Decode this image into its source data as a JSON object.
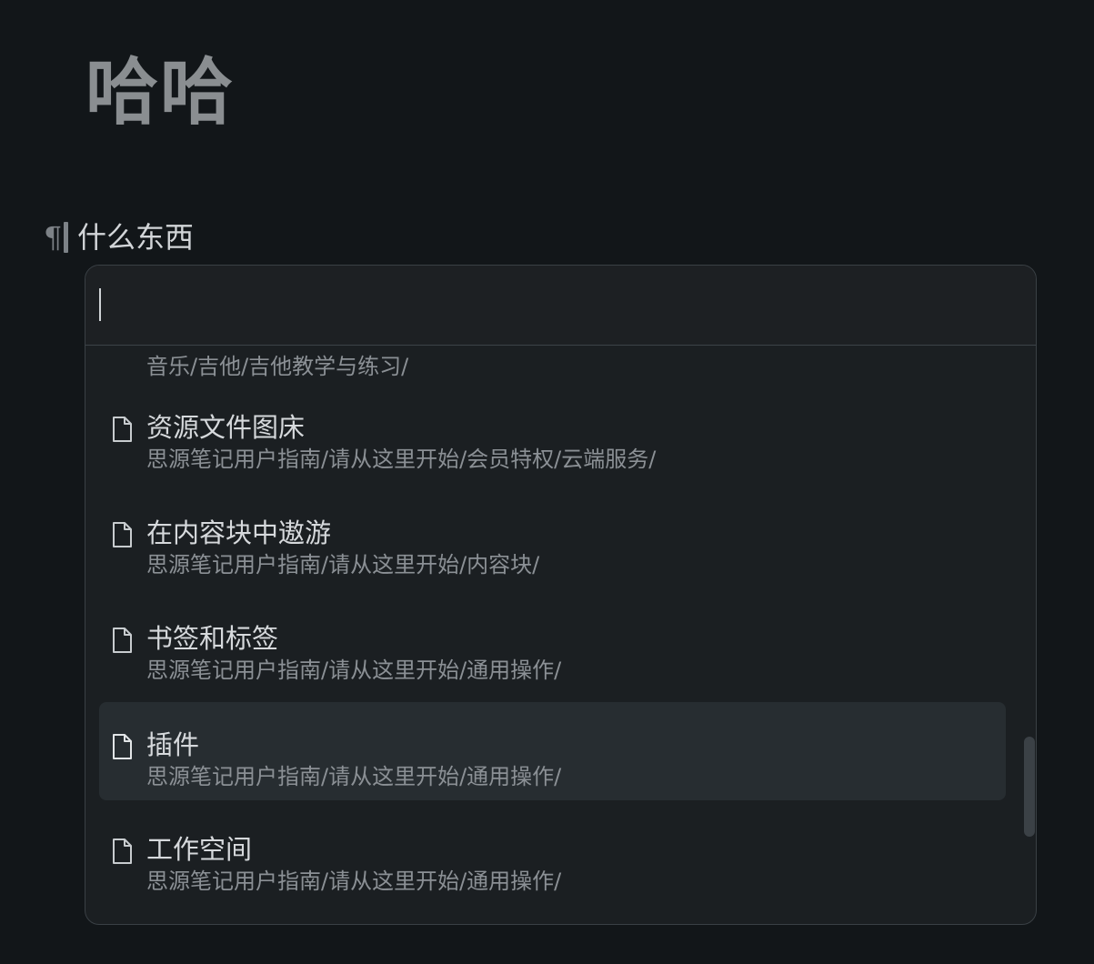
{
  "document": {
    "title": "哈哈",
    "paragraph_marker": "¶",
    "paragraph_text": "什么东西"
  },
  "search": {
    "value": "",
    "placeholder": ""
  },
  "results": {
    "top_partial_path": "音乐/吉他/吉他教学与练习/",
    "items": [
      {
        "title": "资源文件图床",
        "path": "思源笔记用户指南/请从这里开始/会员特权/云端服务/",
        "icon": "document-icon"
      },
      {
        "title": "在内容块中遨游",
        "path": "思源笔记用户指南/请从这里开始/内容块/",
        "icon": "document-icon"
      },
      {
        "title": "书签和标签",
        "path": "思源笔记用户指南/请从这里开始/通用操作/",
        "icon": "document-icon"
      },
      {
        "title": "插件",
        "path": "思源笔记用户指南/请从这里开始/通用操作/",
        "icon": "document-icon",
        "active": true
      },
      {
        "title": "工作空间",
        "path": "思源笔记用户指南/请从这里开始/通用操作/",
        "icon": "document-icon"
      }
    ]
  },
  "colors": {
    "background": "#121619",
    "popup": "#1b1f22",
    "active_row": "#272d31",
    "text_primary": "#d6d9dc",
    "text_secondary": "#8b9095",
    "title": "#8a8e91"
  }
}
